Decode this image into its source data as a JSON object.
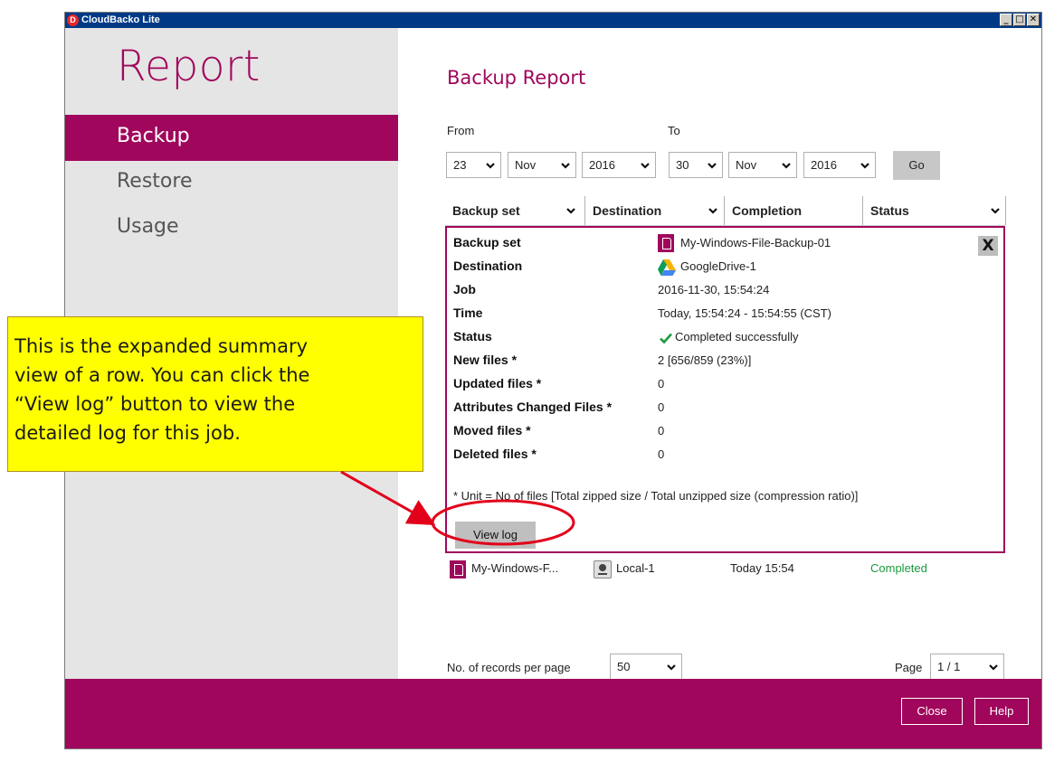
{
  "window": {
    "title": "CloudBacko Lite",
    "logo_glyph": "D",
    "controls": [
      "_",
      "□",
      "✕"
    ]
  },
  "sidebar": {
    "title": "Report",
    "items": [
      {
        "label": "Backup",
        "active": true
      },
      {
        "label": "Restore",
        "active": false
      },
      {
        "label": "Usage",
        "active": false
      }
    ]
  },
  "main": {
    "title": "Backup Report",
    "from_label": "From",
    "to_label": "To",
    "from": {
      "day": "23",
      "month": "Nov",
      "year": "2016"
    },
    "to": {
      "day": "30",
      "month": "Nov",
      "year": "2016"
    },
    "go_label": "Go",
    "columns": [
      "Backup set",
      "Destination",
      "Completion",
      "Status"
    ],
    "detail": {
      "rows": [
        {
          "label": "Backup set",
          "value": "My-Windows-File-Backup-01",
          "icon": "file-icon"
        },
        {
          "label": "Destination",
          "value": "GoogleDrive-1",
          "icon": "google-drive-icon"
        },
        {
          "label": "Job",
          "value": "2016-11-30, 15:54:24"
        },
        {
          "label": "Time",
          "value": "Today, 15:54:24 - 15:54:55 (CST)"
        },
        {
          "label": "Status",
          "value": "Completed successfully",
          "icon": "check-icon"
        },
        {
          "label": "New files *",
          "value": "2 [656/859 (23%)]"
        },
        {
          "label": "Updated files *",
          "value": "0"
        },
        {
          "label": "Attributes Changed Files *",
          "value": "0"
        },
        {
          "label": "Moved files *",
          "value": "0"
        },
        {
          "label": "Deleted files *",
          "value": "0"
        }
      ],
      "note": "* Unit = No of files [Total zipped size / Total unzipped size (compression ratio)]",
      "view_log_label": "View log",
      "close_glyph": "X"
    },
    "row": {
      "backup_set": "My-Windows-F...",
      "destination": "Local-1",
      "completion": "Today 15:54",
      "status": "Completed"
    },
    "records_label": "No. of records per page",
    "records_value": "50",
    "page_label": "Page",
    "page_value": "1 / 1"
  },
  "footer": {
    "close_label": "Close",
    "help_label": "Help"
  },
  "callout": {
    "text": "This is the expanded summary\nview of a row. You can click the\n“View log” button to view the\ndetailed log for this job."
  },
  "colors": {
    "brand": "#a0075c",
    "title_bar": "#003a87",
    "callout": "#ffff00",
    "success": "#1a9b3c",
    "annotation": "#e2001a"
  }
}
